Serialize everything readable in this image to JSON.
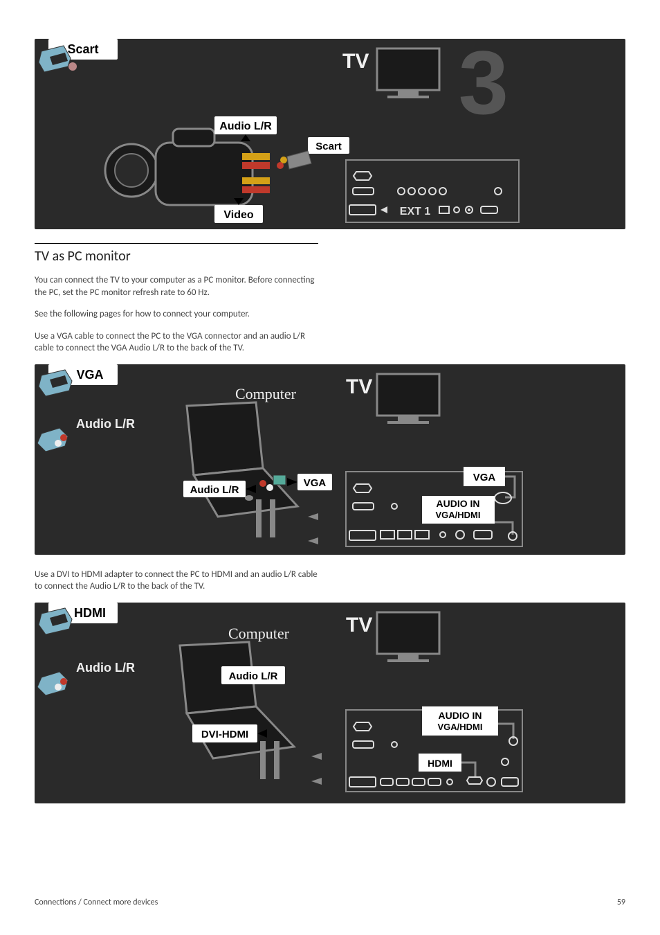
{
  "section": {
    "heading": "TV as PC monitor",
    "p1": "You can connect the TV to your computer as a PC monitor. Before connecting the PC, set the PC monitor refresh rate to 60 Hz.",
    "p2": "See the following pages for how to connect your computer.",
    "p3": "Use a VGA cable to connect the PC to the VGA connector and an audio L/R cable to connect the VGA Audio L/R to the back of the TV.",
    "p4": "Use a DVI to HDMI adapter to connect the PC to HDMI and an audio L/R cable to connect the Audio L/R to the back of the TV."
  },
  "diagram1": {
    "scart_tag": "Scart",
    "tv": "TV",
    "big3": "3",
    "audio_lr": "Audio L/R",
    "scart_mid": "Scart",
    "video": "Video",
    "ext1": "EXT 1"
  },
  "diagram2": {
    "vga_tag": "VGA",
    "audio_tag": "Audio L/R",
    "computer": "Computer",
    "tv": "TV",
    "audio_lr_mid": "Audio L/R",
    "vga_mid": "VGA",
    "vga_port": "VGA",
    "audio_in": "AUDIO IN",
    "vga_hdmi": "VGA/HDMI"
  },
  "diagram3": {
    "hdmi_tag": "HDMI",
    "audio_tag": "Audio L/R",
    "computer": "Computer",
    "tv": "TV",
    "audio_lr_mid": "Audio L/R",
    "dvi_hdmi": "DVI-HDMI",
    "audio_in": "AUDIO IN",
    "vga_hdmi": "VGA/HDMI",
    "hdmi_port": "HDMI"
  },
  "footer": {
    "path": "Connections / Connect more devices",
    "page": "59"
  }
}
